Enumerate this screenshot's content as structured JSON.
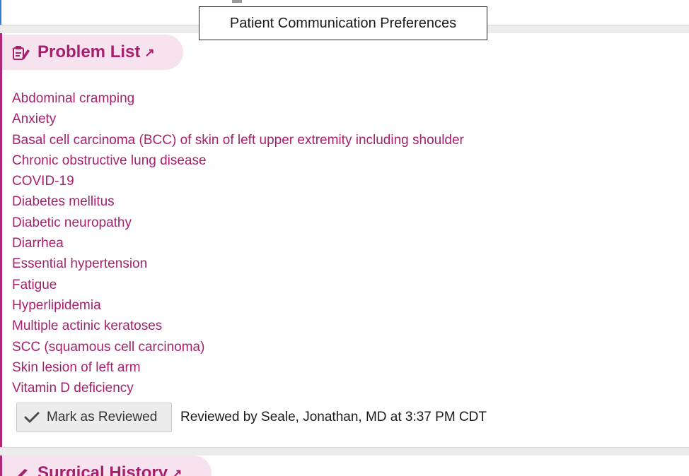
{
  "tooltip": {
    "text": "Patient Communication Preferences"
  },
  "problem_list": {
    "title": "Problem List",
    "popout_glyph": "↗",
    "items": [
      "Abdominal cramping",
      "Anxiety",
      "Basal cell carcinoma (BCC) of skin of left upper extremity including shoulder",
      "Chronic obstructive lung disease",
      "COVID-19",
      "Diabetes mellitus",
      "Diabetic neuropathy",
      "Diarrhea",
      "Essential hypertension",
      "Fatigue",
      "Hyperlipidemia",
      "Multiple actinic keratoses",
      "SCC (squamous cell carcinoma)",
      "Skin lesion of left arm",
      "Vitamin D deficiency"
    ],
    "review_button": "Mark as Reviewed",
    "review_status": "Reviewed by Seale, Jonathan, MD at 3:37 PM CDT"
  },
  "surgical_history": {
    "title": "Surgical History",
    "popout_glyph": "↗"
  },
  "colors": {
    "accent": "#a6206e",
    "pill_bg": "#f6e3ee",
    "border": "#b0277a"
  },
  "icons": {
    "problem_list": "clipboard-edit-icon",
    "surgical_history": "scalpel-icon",
    "review": "checkmark-icon"
  }
}
